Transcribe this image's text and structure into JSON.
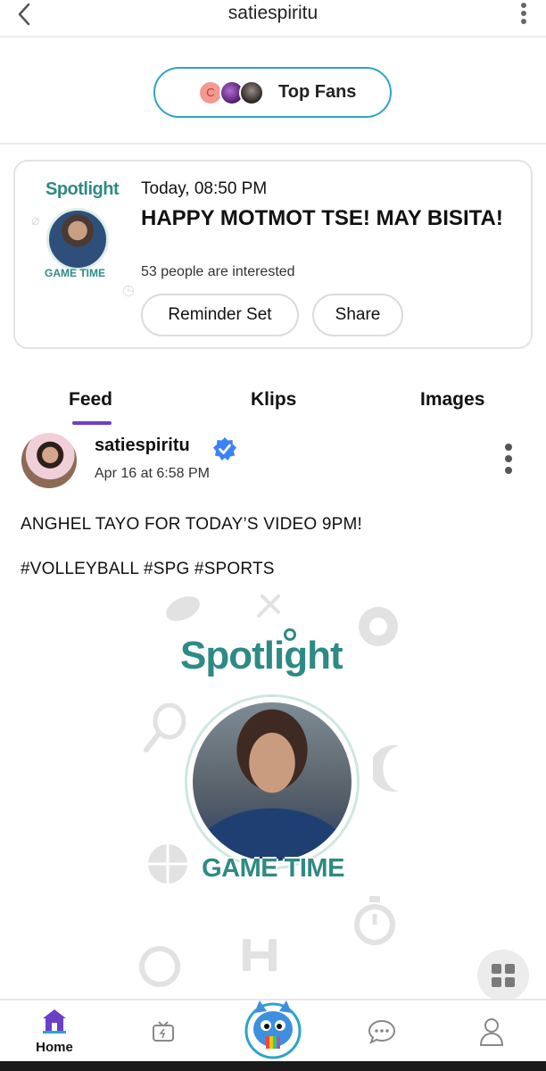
{
  "header": {
    "title": "satiespiritu"
  },
  "top_fans": {
    "label": "Top Fans",
    "first_avatar_letter": "C"
  },
  "event": {
    "thumb_logo": "Spotlight",
    "thumb_badge": "GAME TIME",
    "time": "Today, 08:50 PM",
    "title": "HAPPY MOTMOT TSE! MAY BISITA!",
    "interest": "53 people are interested",
    "reminder_label": "Reminder Set",
    "share_label": "Share"
  },
  "tabs": [
    {
      "label": "Feed",
      "active": true
    },
    {
      "label": "Klips",
      "active": false
    },
    {
      "label": "Images",
      "active": false
    }
  ],
  "post": {
    "username": "satiespiritu",
    "date": "Apr 16 at 6:58 PM",
    "text": "ANGHEL TAYO FOR TODAY’S VIDEO 9PM!",
    "tags": "#VOLLEYBALL #SPG #SPORTS",
    "image_logo": "Spotlight",
    "image_badge": "GAME TIME"
  },
  "nav": {
    "home_label": "Home",
    "items": [
      "home-icon",
      "tv-icon",
      "mascot-icon",
      "chat-icon",
      "profile-icon"
    ]
  },
  "colors": {
    "accent_purple": "#6c3fc9",
    "fans_border": "#2ea3c7",
    "brand_teal": "#2e8a84",
    "verified_blue": "#3b82f6"
  }
}
